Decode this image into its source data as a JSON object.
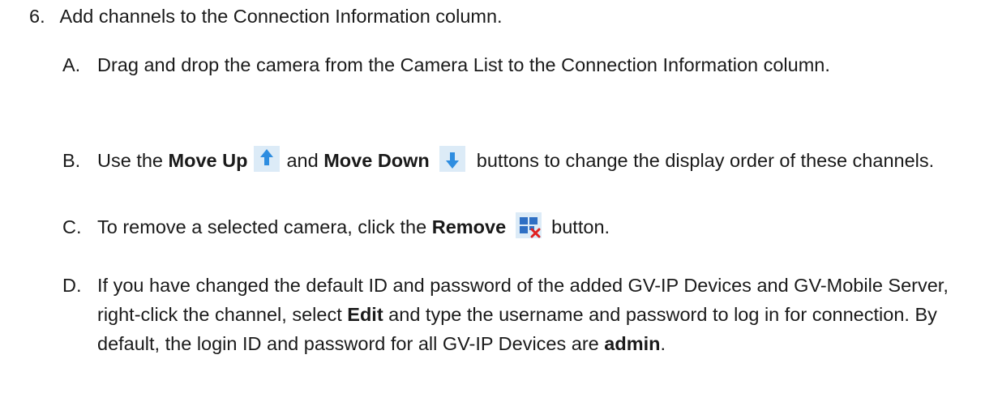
{
  "step": {
    "number": "6.",
    "title": "Add channels to the Connection Information column."
  },
  "items": [
    {
      "letter": "A.",
      "text": "Drag and drop the camera from the Camera List to the Connection Information column."
    },
    {
      "letter": "B.",
      "pre": "Use the ",
      "move_up_label": "Move Up",
      "mid": "and ",
      "move_down_label": "Move Down",
      "post": "buttons to change the display order of these channels."
    },
    {
      "letter": "C.",
      "pre": "To remove a selected camera, click the ",
      "remove_label": "Remove",
      "post": "button."
    },
    {
      "letter": "D.",
      "pre": "If you have changed the default ID and password of the added GV-IP Devices and GV-Mobile Server, right-click the channel, select ",
      "edit_label": "Edit",
      "mid": " and type the username and password to log in for connection. By default, the login ID and password for all GV-IP Devices are ",
      "admin_label": "admin",
      "post": "."
    }
  ],
  "icons": {
    "move_up": "arrow-up-icon",
    "move_down": "arrow-down-icon",
    "remove": "remove-grid-icon",
    "arrow_color": "#2e8de0",
    "icon_bg": "#dcebf7",
    "remove_x_color": "#e02020"
  }
}
